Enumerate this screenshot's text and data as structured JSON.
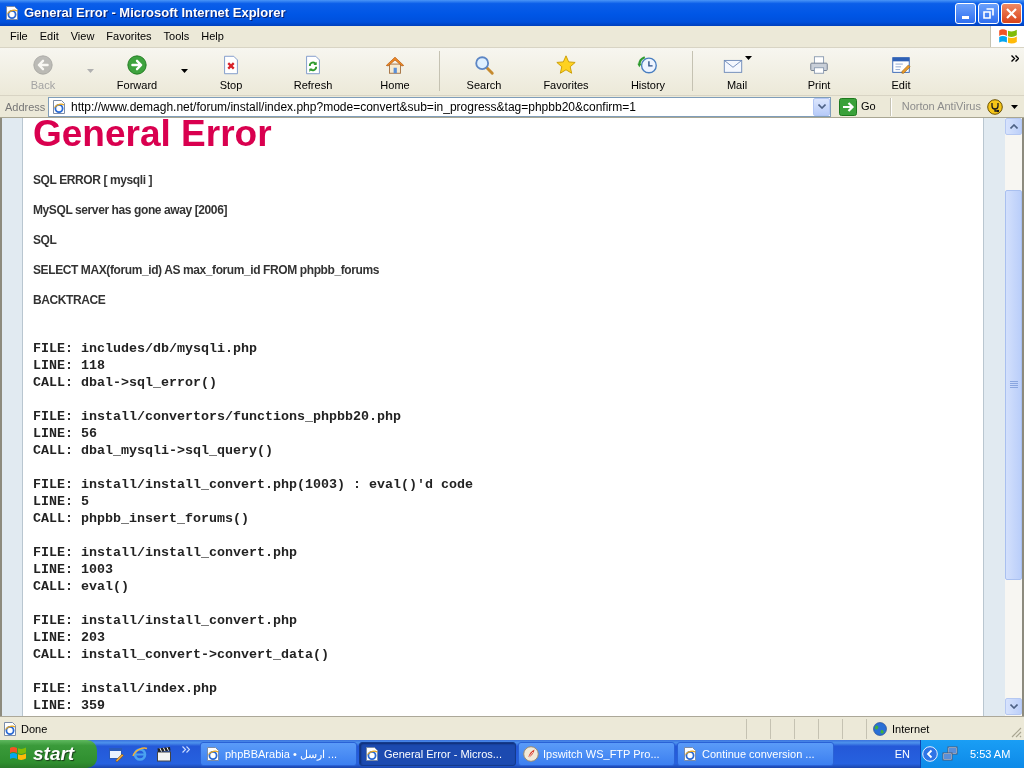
{
  "window": {
    "title": "General Error - Microsoft Internet Explorer"
  },
  "menu": [
    "File",
    "Edit",
    "View",
    "Favorites",
    "Tools",
    "Help"
  ],
  "toolbar": {
    "groups": [
      {
        "buttons": [
          {
            "kind": "back",
            "label": "Back",
            "disabled": true,
            "dropdown": true
          },
          {
            "kind": "forward",
            "label": "Forward",
            "disabled": false,
            "dropdown": true
          },
          {
            "kind": "stop",
            "label": "Stop",
            "disabled": false,
            "dropdown": false
          },
          {
            "kind": "refresh",
            "label": "Refresh",
            "disabled": false,
            "dropdown": false
          },
          {
            "kind": "home",
            "label": "Home",
            "disabled": false,
            "dropdown": false
          }
        ]
      },
      {
        "buttons": [
          {
            "kind": "search",
            "label": "Search",
            "disabled": false,
            "dropdown": false
          },
          {
            "kind": "favorites",
            "label": "Favorites",
            "disabled": false,
            "dropdown": false
          },
          {
            "kind": "history",
            "label": "History",
            "disabled": false,
            "dropdown": false
          }
        ]
      },
      {
        "buttons": [
          {
            "kind": "mail",
            "label": "Mail",
            "disabled": false,
            "dropdown": true
          },
          {
            "kind": "print",
            "label": "Print",
            "disabled": false,
            "dropdown": false
          },
          {
            "kind": "edit",
            "label": "Edit",
            "disabled": false,
            "dropdown": false
          }
        ]
      }
    ]
  },
  "address_bar": {
    "label": "Address",
    "url": "http://www.demagh.net/forum/install/index.php?mode=convert&sub=in_progress&tag=phpbb20&confirm=1",
    "go": "Go",
    "addon": "Norton AntiVirus"
  },
  "page": {
    "heading": "General Error",
    "paragraphs": [
      "SQL ERROR [ mysqli ]",
      "MySQL server has gone away [2006]",
      "SQL",
      "SELECT MAX(forum_id) AS max_forum_id FROM phpbb_forums",
      "BACKTRACE"
    ],
    "backtrace": [
      {
        "lines": [
          "FILE: includes/db/mysqli.php",
          "LINE: 118",
          "CALL: dbal->sql_error()"
        ]
      },
      {
        "lines": [
          "FILE: install/convertors/functions_phpbb20.php",
          "LINE: 56",
          "CALL: dbal_mysqli->sql_query()"
        ]
      },
      {
        "lines": [
          "FILE: install/install_convert.php(1003) : eval()'d code",
          "LINE: 5",
          "CALL: phpbb_insert_forums()"
        ]
      },
      {
        "lines": [
          "FILE: install/install_convert.php",
          "LINE: 1003",
          "CALL: eval()"
        ]
      },
      {
        "lines": [
          "FILE: install/install_convert.php",
          "LINE: 203",
          "CALL: install_convert->convert_data()"
        ]
      },
      {
        "lines": [
          "FILE: install/index.php",
          "LINE: 359"
        ]
      }
    ]
  },
  "status_bar": {
    "text": "Done",
    "zone": "Internet"
  },
  "taskbar": {
    "start": "start",
    "tasks": [
      {
        "kind": "browser",
        "label": "phpBBArabia • ارسل ...",
        "selected": false
      },
      {
        "kind": "browser",
        "label": "General Error - Micros...",
        "selected": true
      },
      {
        "kind": "ftp",
        "label": "Ipswitch WS_FTP Pro...",
        "selected": false
      },
      {
        "kind": "browser",
        "label": "Continue conversion ...",
        "selected": false
      }
    ],
    "language": "EN",
    "clock": "5:53 AM"
  }
}
